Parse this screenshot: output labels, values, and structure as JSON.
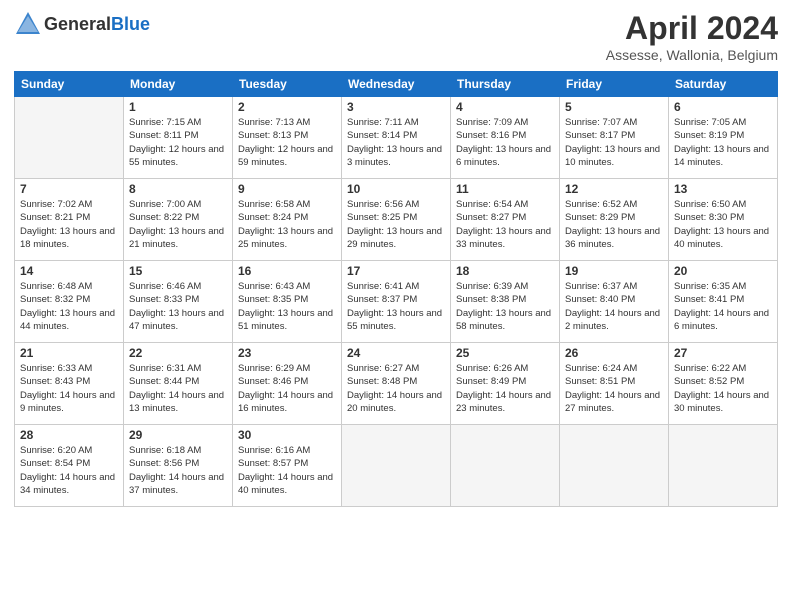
{
  "header": {
    "logo_general": "General",
    "logo_blue": "Blue",
    "title": "April 2024",
    "location": "Assesse, Wallonia, Belgium"
  },
  "weekdays": [
    "Sunday",
    "Monday",
    "Tuesday",
    "Wednesday",
    "Thursday",
    "Friday",
    "Saturday"
  ],
  "weeks": [
    [
      {
        "day": "",
        "empty": true
      },
      {
        "day": "1",
        "sunrise": "Sunrise: 7:15 AM",
        "sunset": "Sunset: 8:11 PM",
        "daylight": "Daylight: 12 hours and 55 minutes."
      },
      {
        "day": "2",
        "sunrise": "Sunrise: 7:13 AM",
        "sunset": "Sunset: 8:13 PM",
        "daylight": "Daylight: 12 hours and 59 minutes."
      },
      {
        "day": "3",
        "sunrise": "Sunrise: 7:11 AM",
        "sunset": "Sunset: 8:14 PM",
        "daylight": "Daylight: 13 hours and 3 minutes."
      },
      {
        "day": "4",
        "sunrise": "Sunrise: 7:09 AM",
        "sunset": "Sunset: 8:16 PM",
        "daylight": "Daylight: 13 hours and 6 minutes."
      },
      {
        "day": "5",
        "sunrise": "Sunrise: 7:07 AM",
        "sunset": "Sunset: 8:17 PM",
        "daylight": "Daylight: 13 hours and 10 minutes."
      },
      {
        "day": "6",
        "sunrise": "Sunrise: 7:05 AM",
        "sunset": "Sunset: 8:19 PM",
        "daylight": "Daylight: 13 hours and 14 minutes."
      }
    ],
    [
      {
        "day": "7",
        "sunrise": "Sunrise: 7:02 AM",
        "sunset": "Sunset: 8:21 PM",
        "daylight": "Daylight: 13 hours and 18 minutes."
      },
      {
        "day": "8",
        "sunrise": "Sunrise: 7:00 AM",
        "sunset": "Sunset: 8:22 PM",
        "daylight": "Daylight: 13 hours and 21 minutes."
      },
      {
        "day": "9",
        "sunrise": "Sunrise: 6:58 AM",
        "sunset": "Sunset: 8:24 PM",
        "daylight": "Daylight: 13 hours and 25 minutes."
      },
      {
        "day": "10",
        "sunrise": "Sunrise: 6:56 AM",
        "sunset": "Sunset: 8:25 PM",
        "daylight": "Daylight: 13 hours and 29 minutes."
      },
      {
        "day": "11",
        "sunrise": "Sunrise: 6:54 AM",
        "sunset": "Sunset: 8:27 PM",
        "daylight": "Daylight: 13 hours and 33 minutes."
      },
      {
        "day": "12",
        "sunrise": "Sunrise: 6:52 AM",
        "sunset": "Sunset: 8:29 PM",
        "daylight": "Daylight: 13 hours and 36 minutes."
      },
      {
        "day": "13",
        "sunrise": "Sunrise: 6:50 AM",
        "sunset": "Sunset: 8:30 PM",
        "daylight": "Daylight: 13 hours and 40 minutes."
      }
    ],
    [
      {
        "day": "14",
        "sunrise": "Sunrise: 6:48 AM",
        "sunset": "Sunset: 8:32 PM",
        "daylight": "Daylight: 13 hours and 44 minutes."
      },
      {
        "day": "15",
        "sunrise": "Sunrise: 6:46 AM",
        "sunset": "Sunset: 8:33 PM",
        "daylight": "Daylight: 13 hours and 47 minutes."
      },
      {
        "day": "16",
        "sunrise": "Sunrise: 6:43 AM",
        "sunset": "Sunset: 8:35 PM",
        "daylight": "Daylight: 13 hours and 51 minutes."
      },
      {
        "day": "17",
        "sunrise": "Sunrise: 6:41 AM",
        "sunset": "Sunset: 8:37 PM",
        "daylight": "Daylight: 13 hours and 55 minutes."
      },
      {
        "day": "18",
        "sunrise": "Sunrise: 6:39 AM",
        "sunset": "Sunset: 8:38 PM",
        "daylight": "Daylight: 13 hours and 58 minutes."
      },
      {
        "day": "19",
        "sunrise": "Sunrise: 6:37 AM",
        "sunset": "Sunset: 8:40 PM",
        "daylight": "Daylight: 14 hours and 2 minutes."
      },
      {
        "day": "20",
        "sunrise": "Sunrise: 6:35 AM",
        "sunset": "Sunset: 8:41 PM",
        "daylight": "Daylight: 14 hours and 6 minutes."
      }
    ],
    [
      {
        "day": "21",
        "sunrise": "Sunrise: 6:33 AM",
        "sunset": "Sunset: 8:43 PM",
        "daylight": "Daylight: 14 hours and 9 minutes."
      },
      {
        "day": "22",
        "sunrise": "Sunrise: 6:31 AM",
        "sunset": "Sunset: 8:44 PM",
        "daylight": "Daylight: 14 hours and 13 minutes."
      },
      {
        "day": "23",
        "sunrise": "Sunrise: 6:29 AM",
        "sunset": "Sunset: 8:46 PM",
        "daylight": "Daylight: 14 hours and 16 minutes."
      },
      {
        "day": "24",
        "sunrise": "Sunrise: 6:27 AM",
        "sunset": "Sunset: 8:48 PM",
        "daylight": "Daylight: 14 hours and 20 minutes."
      },
      {
        "day": "25",
        "sunrise": "Sunrise: 6:26 AM",
        "sunset": "Sunset: 8:49 PM",
        "daylight": "Daylight: 14 hours and 23 minutes."
      },
      {
        "day": "26",
        "sunrise": "Sunrise: 6:24 AM",
        "sunset": "Sunset: 8:51 PM",
        "daylight": "Daylight: 14 hours and 27 minutes."
      },
      {
        "day": "27",
        "sunrise": "Sunrise: 6:22 AM",
        "sunset": "Sunset: 8:52 PM",
        "daylight": "Daylight: 14 hours and 30 minutes."
      }
    ],
    [
      {
        "day": "28",
        "sunrise": "Sunrise: 6:20 AM",
        "sunset": "Sunset: 8:54 PM",
        "daylight": "Daylight: 14 hours and 34 minutes."
      },
      {
        "day": "29",
        "sunrise": "Sunrise: 6:18 AM",
        "sunset": "Sunset: 8:56 PM",
        "daylight": "Daylight: 14 hours and 37 minutes."
      },
      {
        "day": "30",
        "sunrise": "Sunrise: 6:16 AM",
        "sunset": "Sunset: 8:57 PM",
        "daylight": "Daylight: 14 hours and 40 minutes."
      },
      {
        "day": "",
        "empty": true
      },
      {
        "day": "",
        "empty": true
      },
      {
        "day": "",
        "empty": true
      },
      {
        "day": "",
        "empty": true
      }
    ]
  ]
}
